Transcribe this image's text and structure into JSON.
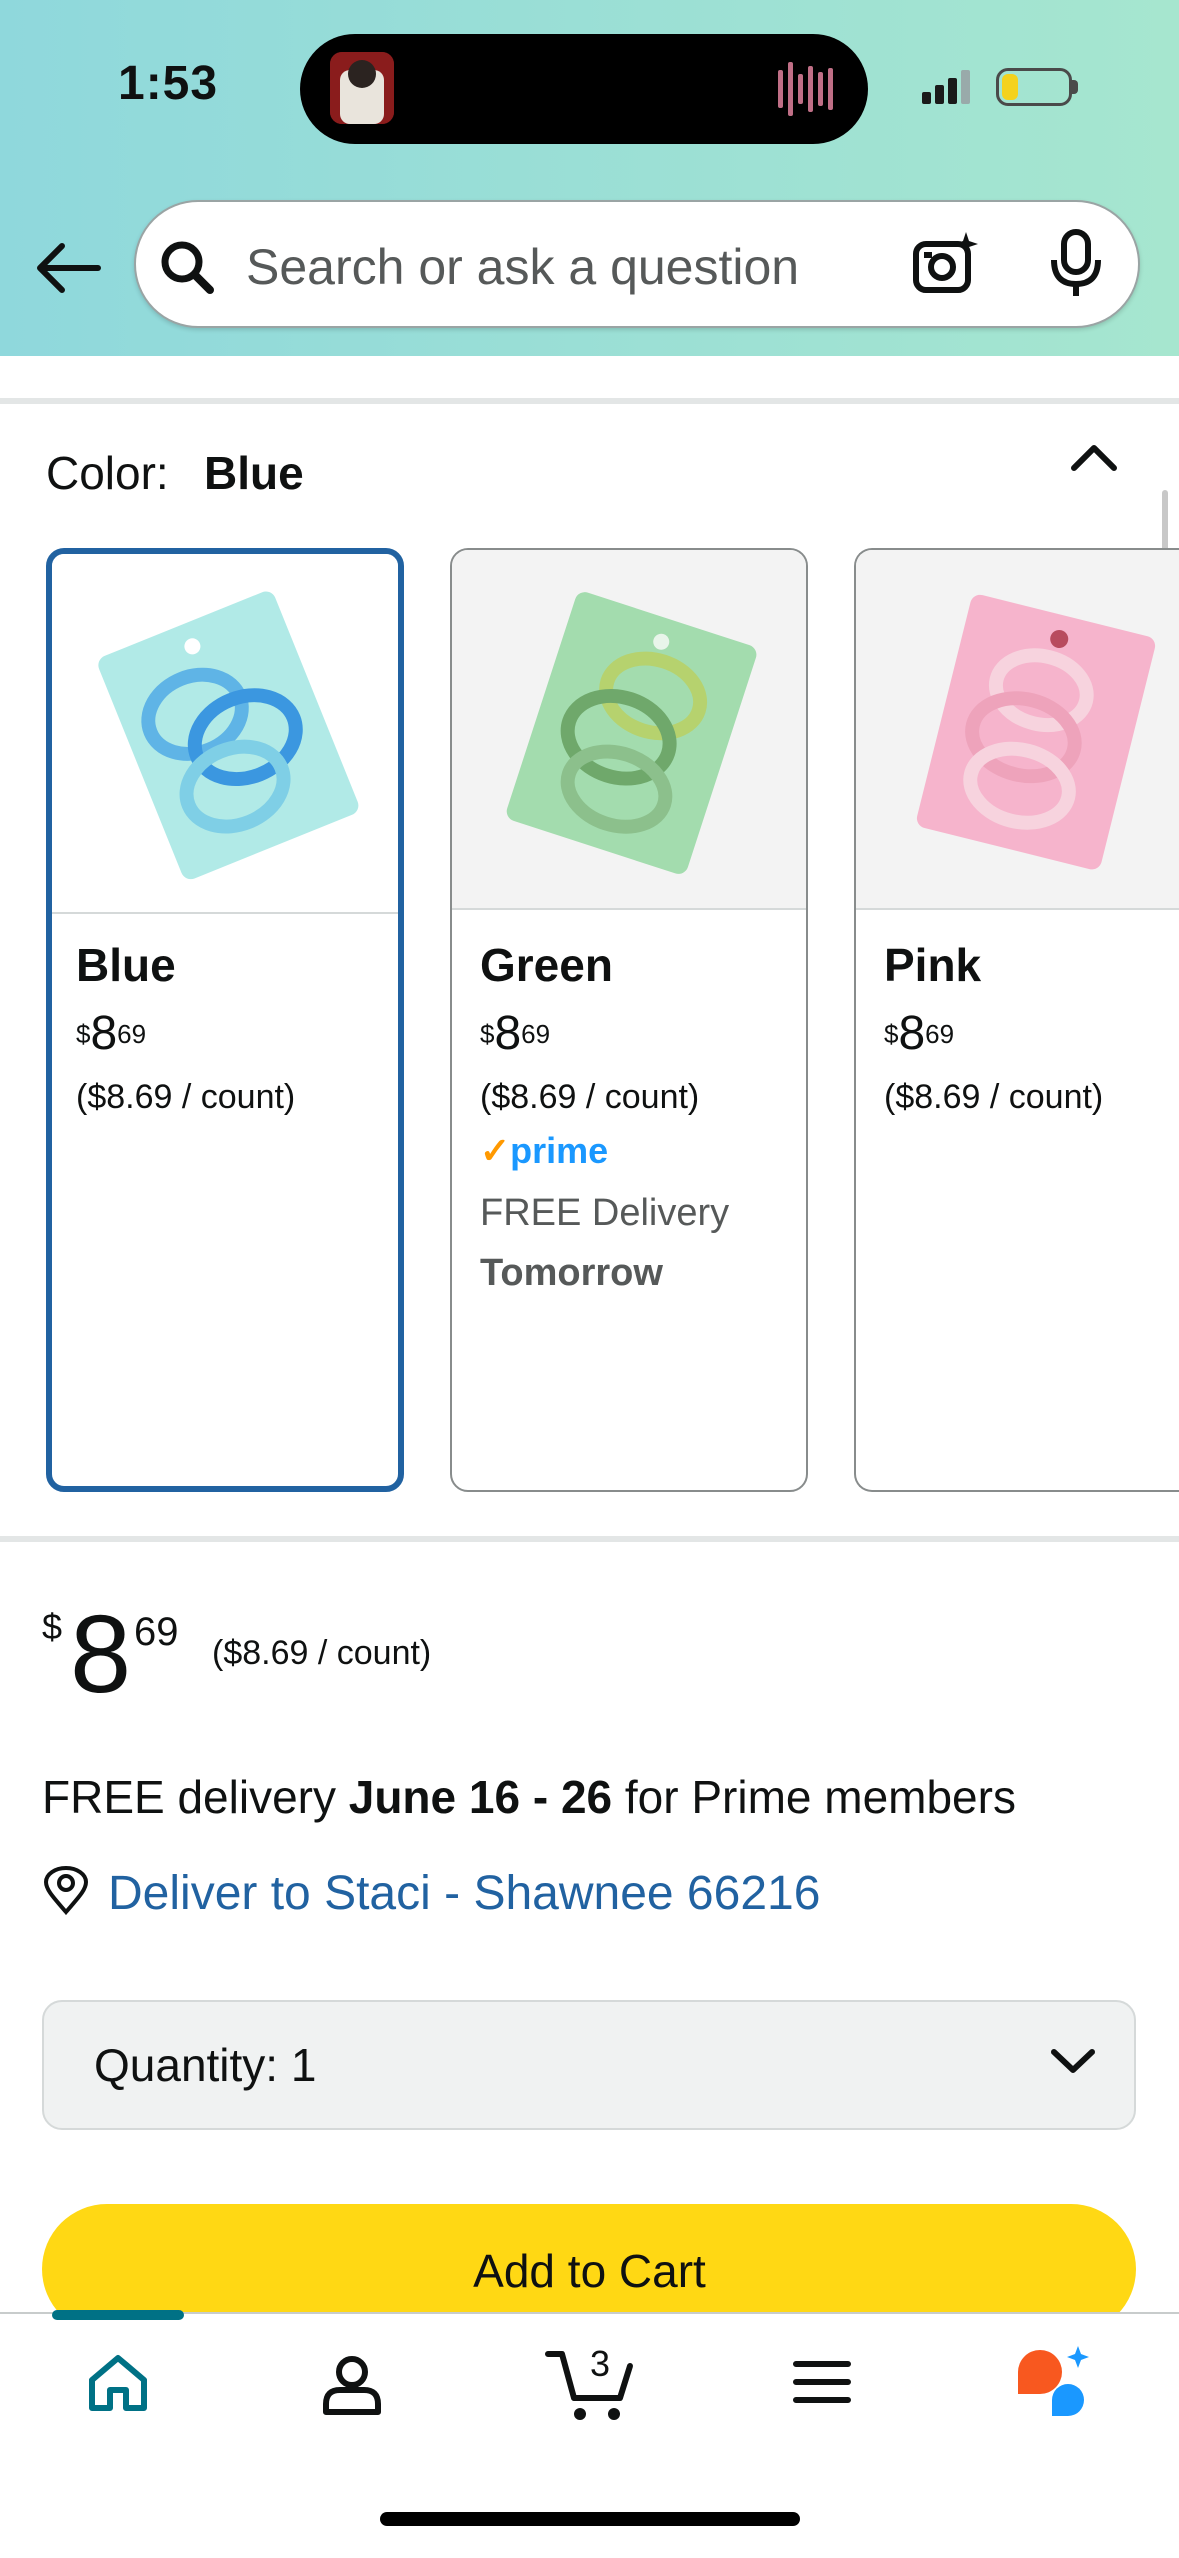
{
  "status_bar": {
    "time": "1:53"
  },
  "search": {
    "placeholder": "Search or ask a question"
  },
  "color_section": {
    "label": "Color:",
    "selected": "Blue",
    "options": [
      {
        "name": "Blue",
        "currency": "$",
        "whole": "8",
        "fraction": "69",
        "unit_price": "($8.69 / count)",
        "selected": true
      },
      {
        "name": "Green",
        "currency": "$",
        "whole": "8",
        "fraction": "69",
        "unit_price": "($8.69 / count)",
        "prime": "prime",
        "prime_check": "✓",
        "delivery": "FREE Delivery",
        "delivery_day": "Tomorrow"
      },
      {
        "name": "Pink",
        "currency": "$",
        "whole": "8",
        "fraction": "69",
        "unit_price": "($8.69 / count)"
      }
    ]
  },
  "buy_box": {
    "currency": "$",
    "whole": "8",
    "fraction": "69",
    "unit_price": "($8.69 / count)",
    "delivery_prefix": "FREE delivery ",
    "delivery_dates": "June 16 - 26",
    "delivery_suffix": " for Prime members",
    "deliver_to": "Deliver to Staci - Shawnee 66216",
    "quantity_label": "Quantity:",
    "quantity_value": "1",
    "add_to_cart": "Add to Cart"
  },
  "nav": {
    "cart_count": "3"
  },
  "colors": {
    "accent_blue": "#2162a1",
    "cart_button": "#ffd814",
    "prime_blue": "#1a98ff",
    "teal": "#007185"
  }
}
